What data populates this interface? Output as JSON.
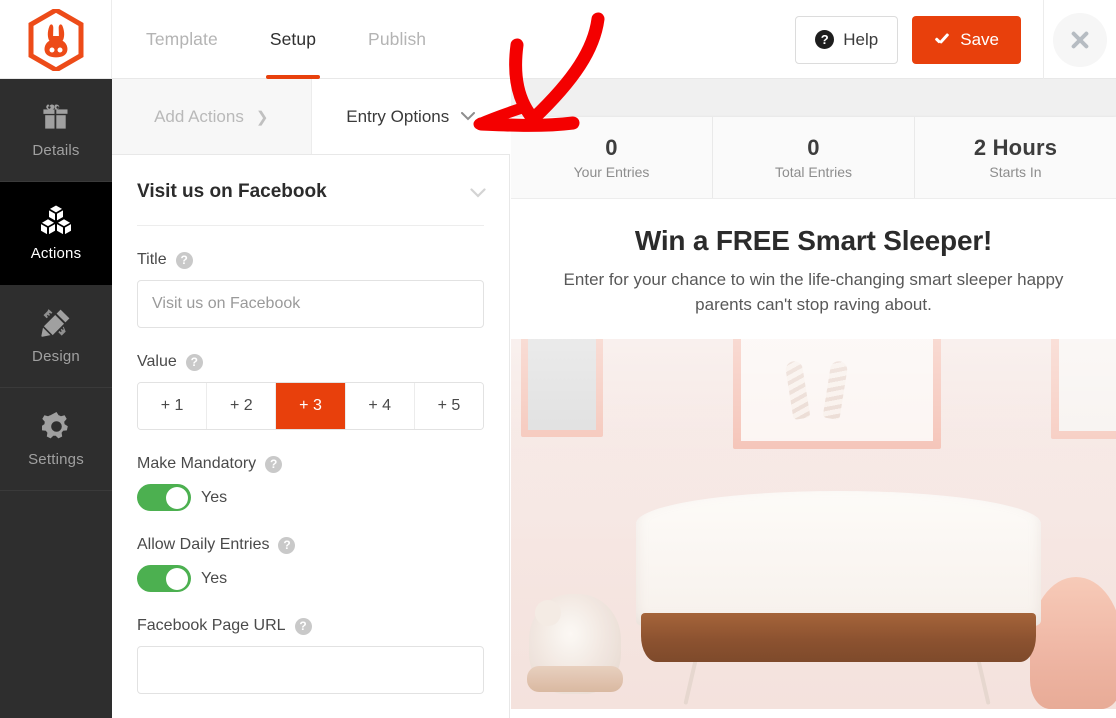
{
  "app": {
    "logo_icon": "rabbit-hexagon-logo",
    "accent_color": "#e8400c",
    "toggle_color": "#4cb050",
    "annotation_color": "#ff0000"
  },
  "topbar": {
    "tabs": [
      {
        "label": "Template",
        "active": false
      },
      {
        "label": "Setup",
        "active": true
      },
      {
        "label": "Publish",
        "active": false
      }
    ],
    "help_label": "Help",
    "help_icon": "question-circle-icon",
    "save_label": "Save",
    "save_icon": "check-icon",
    "close_icon": "close-icon"
  },
  "sidebar": {
    "items": [
      {
        "label": "Details",
        "icon": "gift-icon",
        "active": false
      },
      {
        "label": "Actions",
        "icon": "cubes-icon",
        "active": true
      },
      {
        "label": "Design",
        "icon": "pencil-ruler-icon",
        "active": false
      },
      {
        "label": "Settings",
        "icon": "gear-icon",
        "active": false
      }
    ]
  },
  "subtabs": [
    {
      "label": "Add Actions",
      "icon": "chevron-right-icon",
      "active": false
    },
    {
      "label": "Entry Options",
      "icon": "chevron-down-icon",
      "active": true
    }
  ],
  "form": {
    "accordion_title": "Visit us on Facebook",
    "accordion_icon": "chevron-down-icon",
    "title_label": "Title",
    "title_help_icon": "question-circle-icon",
    "title_placeholder": "Visit us on Facebook",
    "title_value": "",
    "value_label": "Value",
    "value_help_icon": "question-circle-icon",
    "value_options": [
      "+ 1",
      "+ 2",
      "+ 3",
      "+ 4",
      "+ 5"
    ],
    "value_selected": "+ 3",
    "mandatory_label": "Make Mandatory",
    "mandatory_help_icon": "question-circle-icon",
    "mandatory_state": "Yes",
    "daily_label": "Allow Daily Entries",
    "daily_help_icon": "question-circle-icon",
    "daily_state": "Yes",
    "url_label": "Facebook Page URL",
    "url_help_icon": "question-circle-icon",
    "url_value": "",
    "url_placeholder": ""
  },
  "preview": {
    "stats": [
      {
        "number": "0",
        "label": "Your Entries"
      },
      {
        "number": "0",
        "label": "Total Entries"
      },
      {
        "number": "2 Hours",
        "label": "Starts In"
      }
    ],
    "headline": "Win a FREE Smart Sleeper!",
    "subtext": "Enter for your chance to win the life-changing smart sleeper happy parents can't stop raving about.",
    "image_alt": "nursery-bassinet-photo"
  },
  "annotation": {
    "type": "hand-drawn-arrow",
    "points_to": "entry-options-chevron"
  }
}
